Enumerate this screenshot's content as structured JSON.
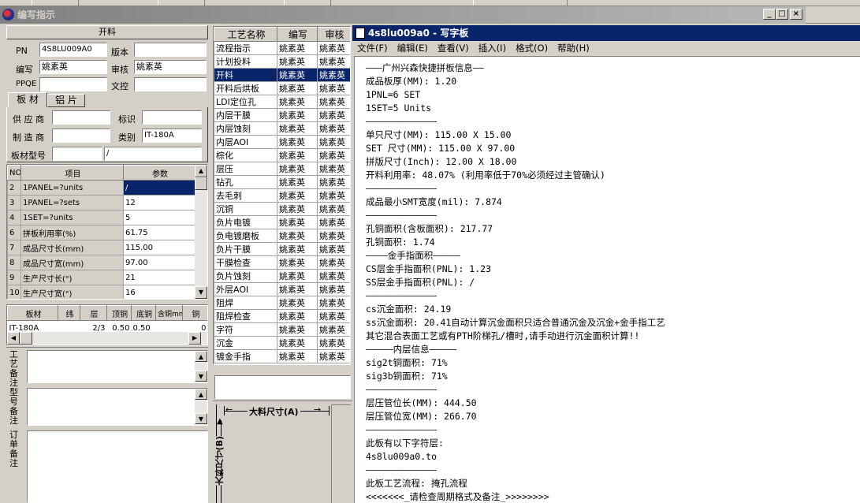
{
  "window": {
    "title": "编写指示",
    "min": "_",
    "max": "□",
    "close": "×"
  },
  "section_header": "开料",
  "info": {
    "pn_label": "PN",
    "pn_value": "4S8LU009A0",
    "version_label": "版本",
    "version_value": "",
    "author_label": "编写",
    "author_value": "姚素英",
    "reviewer_label": "审核",
    "reviewer_value": "姚素英",
    "ppqe_label": "PPQE",
    "ppqe_value": "",
    "textreview_label": "文控",
    "textreview_value": ""
  },
  "tabs": [
    "板 材",
    "铝 片"
  ],
  "material": {
    "supplier_label": "供 应 商",
    "supplier_value": "",
    "mark_label": "标识",
    "mark_value": "",
    "maker_label": "制 造 商",
    "maker_value": "",
    "category_label": "类别",
    "category_value": "IT-180A",
    "model_label": "板材型号",
    "model_value": "",
    "model_value2": "/"
  },
  "param_table": {
    "headers": [
      "NO",
      "项目",
      "参数"
    ],
    "rows": [
      [
        "2",
        "1PANEL=?units",
        "/"
      ],
      [
        "3",
        "1PANEL=?sets",
        "12"
      ],
      [
        "4",
        "1SET=?units",
        "5"
      ],
      [
        "6",
        "拼板利用率(%)",
        "61.75"
      ],
      [
        "7",
        "成品尺寸长(mm)",
        "115.00"
      ],
      [
        "8",
        "成品尺寸宽(mm)",
        "97.00"
      ],
      [
        "9",
        "生产尺寸长(\")",
        "21"
      ],
      [
        "10",
        "生产尺寸宽(\")",
        "16"
      ]
    ]
  },
  "board_table": {
    "headers": [
      "板材",
      "纬",
      "层",
      "顶铜",
      "底铜",
      "含铜mm",
      "铜"
    ],
    "row": [
      "IT-180A",
      "",
      "2/3",
      "0.50",
      "0.50",
      "",
      "0"
    ]
  },
  "notes": {
    "process_note_label": "工艺备注",
    "model_note_label": "型号备注",
    "order_note_label": "订单备注"
  },
  "process_list": {
    "headers": [
      "工艺名称",
      "编写",
      "审核"
    ],
    "rows": [
      [
        "流程指示",
        "姚素英",
        "姚素英"
      ],
      [
        "计划投料",
        "姚素英",
        "姚素英"
      ],
      [
        "开料",
        "姚素英",
        "姚素英"
      ],
      [
        "开料后烘板",
        "姚素英",
        "姚素英"
      ],
      [
        "LDI定位孔",
        "姚素英",
        "姚素英"
      ],
      [
        "内层干膜",
        "姚素英",
        "姚素英"
      ],
      [
        "内层蚀刻",
        "姚素英",
        "姚素英"
      ],
      [
        "内层AOI",
        "姚素英",
        "姚素英"
      ],
      [
        "棕化",
        "姚素英",
        "姚素英"
      ],
      [
        "层压",
        "姚素英",
        "姚素英"
      ],
      [
        "钻孔",
        "姚素英",
        "姚素英"
      ],
      [
        "去毛刺",
        "姚素英",
        "姚素英"
      ],
      [
        "沉铜",
        "姚素英",
        "姚素英"
      ],
      [
        "负片电镀",
        "姚素英",
        "姚素英"
      ],
      [
        "负电镀磨板",
        "姚素英",
        "姚素英"
      ],
      [
        "负片干膜",
        "姚素英",
        "姚素英"
      ],
      [
        "干膜检查",
        "姚素英",
        "姚素英"
      ],
      [
        "负片蚀刻",
        "姚素英",
        "姚素英"
      ],
      [
        "外层AOI",
        "姚素英",
        "姚素英"
      ],
      [
        "阻焊",
        "姚素英",
        "姚素英"
      ],
      [
        "阻焊检查",
        "姚素英",
        "姚素英"
      ],
      [
        "字符",
        "姚素英",
        "姚素英"
      ],
      [
        "沉金",
        "姚素英",
        "姚素英"
      ],
      [
        "镀金手指",
        "姚素英",
        "姚素英"
      ]
    ],
    "selected_index": 2
  },
  "diagram": {
    "label_a": "大料尺寸(A)",
    "label_b": "大料尺寸(B)"
  },
  "wordpad": {
    "title": "4s8lu009a0 - 写字板",
    "menu": [
      "文件(F)",
      "编辑(E)",
      "查看(V)",
      "插入(I)",
      "格式(O)",
      "帮助(H)"
    ],
    "lines": [
      "———广州兴森快捷拼板信息——",
      "成品板厚(MM): 1.20",
      "1PNL=6 SET",
      "1SET=5 Units",
      "—————————————",
      "单只尺寸(MM): 115.00 X 15.00",
      "SET 尺寸(MM): 115.00 X 97.00",
      "拼版尺寸(Inch): 12.00 X 18.00",
      "开料利用率: 48.07% (利用率低于70%必须经过主管确认)",
      "—————————————",
      "成品最小SMT宽度(mil): 7.874",
      "—————————————",
      "孔铜面积(含板面积): 217.77",
      "孔铜面积: 1.74",
      "————金手指面积—————",
      "CS层金手指面积(PNL): 1.23",
      "SS层金手指面积(PNL): /",
      "—————————————",
      "cs沉金面积: 24.19",
      "ss沉金面积: 20.41自动计算沉金面积只适合普通沉金及沉金+金手指工艺",
      "其它混合表面工艺或有PTH阶梯孔/槽时,请手动进行沉金面积计算!!",
      "—————内层信息—————",
      "sig2t铜面积: 71%",
      "sig3b铜面积: 71%",
      "—————————————",
      "层压管位长(MM): 444.50",
      "层压管位宽(MM): 266.70",
      "—————————————",
      "此板有以下字符层:",
      "4s8lu009a0.to",
      "—————————————",
      "此板工艺流程: 掩孔流程",
      "<<<<<<<_请检查周期格式及备注_>>>>>>>>"
    ]
  }
}
